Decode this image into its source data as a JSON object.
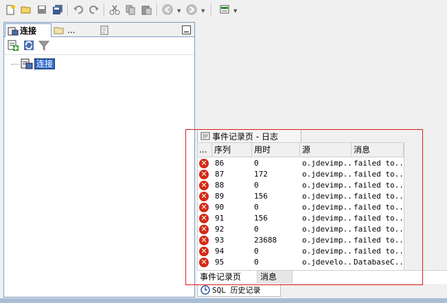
{
  "toolbar": {
    "buttons": [
      "new-icon",
      "open-icon",
      "save-icon",
      "save-all-icon",
      "undo-icon",
      "redo-icon",
      "cut-icon",
      "copy-icon",
      "paste-icon",
      "back-icon",
      "forward-icon",
      "sql-icon"
    ]
  },
  "connections": {
    "tabs": [
      {
        "label": "连接",
        "active": true
      },
      {
        "label": "...",
        "active": false
      }
    ],
    "tree_root": "连接"
  },
  "log": {
    "tab_title": "事件记录页 - 日志",
    "columns": [
      "...",
      "序列",
      "用时",
      "源",
      "消息"
    ],
    "rows": [
      {
        "seq": "86",
        "time": "0",
        "source": "o.jdevimp...",
        "message": "failed to..."
      },
      {
        "seq": "87",
        "time": "172",
        "source": "o.jdevimp...",
        "message": "failed to..."
      },
      {
        "seq": "88",
        "time": "0",
        "source": "o.jdevimp...",
        "message": "failed to..."
      },
      {
        "seq": "89",
        "time": "156",
        "source": "o.jdevimp...",
        "message": "failed to..."
      },
      {
        "seq": "90",
        "time": "0",
        "source": "o.jdevimp...",
        "message": "failed to..."
      },
      {
        "seq": "91",
        "time": "156",
        "source": "o.jdevimp...",
        "message": "failed to..."
      },
      {
        "seq": "92",
        "time": "0",
        "source": "o.jdevimp...",
        "message": "failed to..."
      },
      {
        "seq": "93",
        "time": "23688",
        "source": "o.jdevimp...",
        "message": "failed to..."
      },
      {
        "seq": "94",
        "time": "0",
        "source": "o.jdevimp...",
        "message": "failed to..."
      },
      {
        "seq": "95",
        "time": "0",
        "source": "o.jdevelo...",
        "message": "DatabaseC..."
      }
    ],
    "subtabs": [
      "事件记录页",
      "消息"
    ],
    "sql_history_tab": "SQL 历史记录"
  },
  "colors": {
    "highlight": "#d81a1a",
    "error": "#d42a16",
    "selection": "#3169c6"
  }
}
